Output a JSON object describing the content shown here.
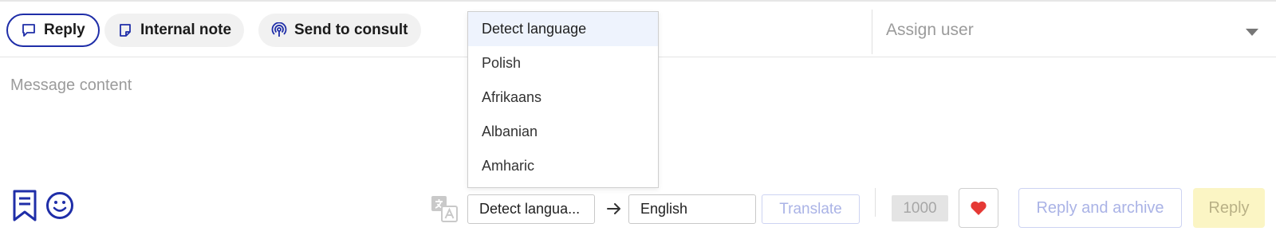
{
  "modes": {
    "reply_label": "Reply",
    "internal_note_label": "Internal note",
    "send_to_consult_label": "Send to consult"
  },
  "assign": {
    "placeholder": "Assign user"
  },
  "message": {
    "placeholder": "Message content"
  },
  "language_dropdown": {
    "options": [
      "Detect language",
      "Polish",
      "Afrikaans",
      "Albanian",
      "Amharic"
    ],
    "selected_index": 0
  },
  "translate": {
    "source_value": "Detect langua...",
    "target_value": "English",
    "button_label": "Translate"
  },
  "footer": {
    "char_limit": "1000",
    "reply_archive_label": "Reply and archive",
    "reply_label": "Reply"
  },
  "icons": {
    "reply": "chat-bubble-icon",
    "internal_note": "sticky-note-icon",
    "send_to_consult": "broadcast-icon",
    "saved_replies": "bookmark-icon",
    "emoji": "smiley-icon",
    "translate": "translate-icon",
    "arrow": "arrow-right-icon",
    "heart": "heart-icon",
    "assign_caret": "chevron-down-icon"
  },
  "colors": {
    "accent": "#1f2ea8",
    "reply_button_bg": "#fbf5c4",
    "heart": "#e53935"
  }
}
